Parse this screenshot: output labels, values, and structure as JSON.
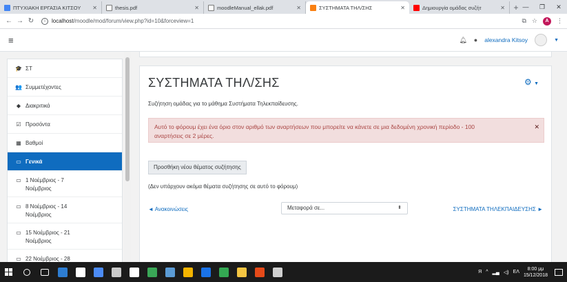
{
  "browser": {
    "tabs": [
      {
        "label": "ΠΤΥΧΙΑΚΗ ΕΡΓΑΣΙΑ ΚΙΤΣΟΥ",
        "icon": "docs-icon",
        "color": "#4285f4"
      },
      {
        "label": "thesis.pdf",
        "icon": "file-icon",
        "color": "#ffffff"
      },
      {
        "label": "moodleManual_ellak.pdf",
        "icon": "file-icon",
        "color": "#ffffff"
      },
      {
        "label": "ΣΥΣΤΗΜΑΤΑ ΤΗΛ/ΣΗΣ",
        "icon": "moodle-icon",
        "color": "#f98012"
      },
      {
        "label": "Δημιουργία ομάδας συζήτ",
        "icon": "youtube-icon",
        "color": "#ff0000"
      }
    ],
    "url_host": "localhost",
    "url_path": "/moodle/mod/forum/view.php?id=10&forceview=1",
    "avatar_letter": "A"
  },
  "navbar": {
    "username": "alexandra Kitsoy"
  },
  "drawer": {
    "items": [
      {
        "label": "ΣΤ",
        "icon": "graduation-cap-icon",
        "glyph": "🎓"
      },
      {
        "label": "Συμμετέχοντες",
        "icon": "users-icon",
        "glyph": "👥"
      },
      {
        "label": "Διακριτικά",
        "icon": "shield-icon",
        "glyph": "◆"
      },
      {
        "label": "Προσόντα",
        "icon": "checkbox-icon",
        "glyph": "☑"
      },
      {
        "label": "Βαθμοί",
        "icon": "table-icon",
        "glyph": "▦"
      },
      {
        "label": "Γενικά",
        "icon": "folder-icon",
        "glyph": "▭",
        "active": true
      },
      {
        "label": "1 Νοέμβριος - 7 Νοέμβριος",
        "icon": "folder-icon",
        "glyph": "▭",
        "l1": "1 Νοέμβριος - 7",
        "l2": "Νοέμβριος"
      },
      {
        "label": "8 Νοέμβριος - 14 Νοέμβριος",
        "icon": "folder-icon",
        "glyph": "▭",
        "l1": "8 Νοέμβριος - 14",
        "l2": "Νοέμβριος"
      },
      {
        "label": "15 Νοέμβριος - 21 Νοέμβριος",
        "icon": "folder-icon",
        "glyph": "▭",
        "l1": "15 Νοέμβριος - 21",
        "l2": "Νοέμβριος"
      },
      {
        "label": "22 Νοέμβριος - 28 Νοέμβριος",
        "icon": "folder-icon",
        "glyph": "▭",
        "l1": "22 Νοέμβριος - 28",
        "l2": "Νοέμβριος"
      }
    ]
  },
  "forum": {
    "title": "ΣΥΣΤΗΜΑΤΑ ΤΗΛ/ΣΗΣ",
    "description": "Συζήτηση ομάδας για το μάθημα Συστήματα Τηλεκπαίδευσης.",
    "alert_line1": "Αυτό το φόρουμ έχει ένα όριο στον αριθμό των αναρτήσεων που μπορείτε να κάνετε σε μια δεδομένη χρονική περίοδο - 100",
    "alert_line2": "αναρτήσεις σε 2 μέρες.",
    "add_discussion": "Προσθήκη νέου θέματος συζήτησης",
    "no_discussions": "(Δεν υπάρχουν ακόμα θέματα συζήτησης σε αυτό το φόρουμ)",
    "prev_link": "◄ Ανακοινώσεις",
    "jump_to": "Μεταφορά σε...",
    "next_link": "ΣΥΣΤΗΜΑΤΑ ΤΗΛΕΚΠΑΙΔΕΥΣΗΣ ►"
  },
  "taskbar": {
    "apps": [
      {
        "icon": "search-icon",
        "color": "#1b1b1b"
      },
      {
        "icon": "task-view-icon",
        "color": "#1b1b1b"
      },
      {
        "icon": "edge-icon",
        "color": "#2d7dd2"
      },
      {
        "icon": "store-icon",
        "color": "#ffffff"
      },
      {
        "icon": "photos-icon",
        "color": "#4c8bf5"
      },
      {
        "icon": "media-icon",
        "color": "#c9c9c9"
      },
      {
        "icon": "amazon-icon",
        "color": "#ffffff"
      },
      {
        "icon": "maps-icon",
        "color": "#3aa757"
      },
      {
        "icon": "mail-icon",
        "color": "#5b9bd5"
      },
      {
        "icon": "people-icon",
        "color": "#f4b400"
      },
      {
        "icon": "drive-icon",
        "color": "#1a73e8"
      },
      {
        "icon": "chrome-icon",
        "color": "#34a853"
      },
      {
        "icon": "explorer-icon",
        "color": "#f4c542"
      },
      {
        "icon": "office-icon",
        "color": "#e64a19"
      },
      {
        "icon": "paint-icon",
        "color": "#d0d0d0"
      }
    ],
    "lang": "ΕΛ",
    "time": "8:00 μμ",
    "date": "15/12/2018"
  }
}
